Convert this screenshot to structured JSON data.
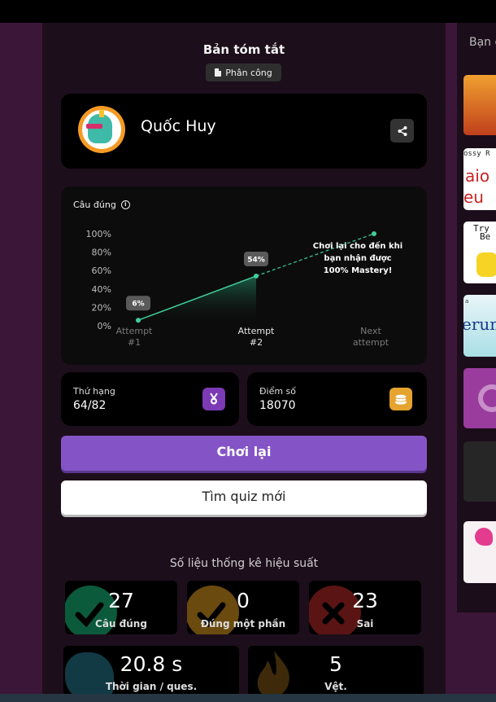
{
  "summary": {
    "title": "Bản tóm tắt",
    "assignment_label": "Phân công"
  },
  "player": {
    "name": "Quốc Huy"
  },
  "chart_data": {
    "type": "line",
    "title": "Câu đúng",
    "categories": [
      "Attempt #1",
      "Attempt #2",
      "Next attempt"
    ],
    "category_lines": [
      [
        "Attempt",
        "#1"
      ],
      [
        "Attempt",
        "#2"
      ],
      [
        "Next",
        "attempt"
      ]
    ],
    "y_ticks": [
      "100%",
      "80%",
      "60%",
      "40%",
      "20%",
      "0%"
    ],
    "ylim": [
      0,
      100
    ],
    "series": [
      {
        "values": [
          6,
          54
        ]
      }
    ],
    "projection": {
      "from": 54,
      "to": 100
    },
    "value_labels": [
      "6%",
      "54%"
    ],
    "annotation": [
      "Chơi lại cho đến khi",
      "bạn nhận được",
      "100% Mastery!"
    ],
    "colors": {
      "line": "#3fcf99",
      "projection": "#35c48e",
      "label_bg": "#5a5a5a"
    }
  },
  "stats": {
    "rank_label": "Thứ hạng",
    "rank_value": "64/82",
    "score_label": "Điểm số",
    "score_value": "18070"
  },
  "buttons": {
    "play_again": "Chơi lại",
    "new_quiz": "Tìm quiz mới"
  },
  "performance": {
    "title": "Số liệu thống kê hiệu suất",
    "correct": {
      "value": "27",
      "label": "Câu đúng"
    },
    "partial": {
      "value": "0",
      "label": "Đúng một phần"
    },
    "wrong": {
      "value": "23",
      "label": "Sai"
    },
    "time": {
      "value": "20.8 s",
      "label": "Thời gian / ques."
    },
    "streak": {
      "value": "5",
      "label": "Vệt."
    }
  },
  "right_panel": {
    "title": "Bạn c",
    "thumb_texts": [
      "ossy R",
      "aio",
      "eu",
      "Try",
      "Be",
      "a",
      "erum"
    ]
  },
  "colors": {
    "accent": "#8454c6",
    "rank_icon_bg": "#7c3ab5",
    "score_icon_bg": "#e5a32f"
  }
}
